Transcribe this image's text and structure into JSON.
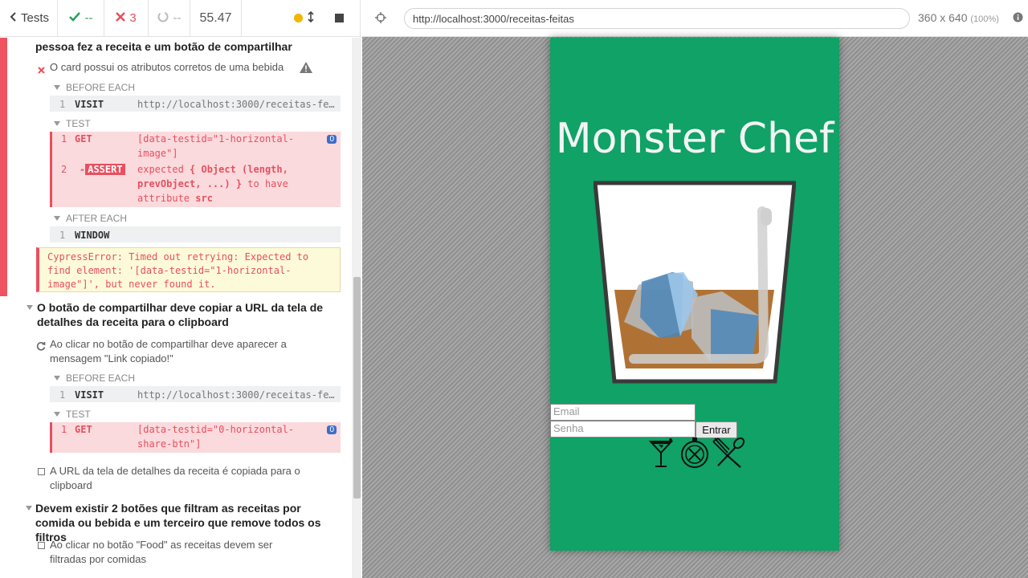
{
  "topbar": {
    "back_label": "Tests",
    "passed": "--",
    "failed": "3",
    "pending": "--",
    "duration": "55.47"
  },
  "reporter": {
    "suite_prev_tail": "pessoa fez a receita e um botão de compartilhar",
    "test1": {
      "title": "O card possui os atributos corretos de uma bebida",
      "before_each": "BEFORE EACH",
      "visit": {
        "num": "1",
        "name": "VISIT",
        "msg": "http://localhost:3000/receitas-feitas"
      },
      "test_label": "TEST",
      "get": {
        "num": "1",
        "name": "GET",
        "msg": "[data-testid=\"1-horizontal-image\"]",
        "badge": "0"
      },
      "assert": {
        "num": "2",
        "name": "ASSERT",
        "msg_a": "expected ",
        "msg_b": "{ Object (length, prevObject, ...) }",
        "msg_c": " to have attribute ",
        "msg_d": "src"
      },
      "after_each": "AFTER EACH",
      "window": {
        "num": "1",
        "name": "WINDOW"
      },
      "error": "CypressError: Timed out retrying: Expected to find element: '[data-testid=\"1-horizontal-image\"]', but never found it."
    },
    "suite2": {
      "title": "O botão de compartilhar deve copiar a URL da tela de detalhes da receita para o clipboard",
      "test": "Ao clicar no botão de compartilhar deve aparecer a mensagem \"Link copiado!\"",
      "before_each": "BEFORE EACH",
      "visit": {
        "num": "1",
        "name": "VISIT",
        "msg": "http://localhost:3000/receitas-feitas"
      },
      "test_label": "TEST",
      "get": {
        "num": "1",
        "name": "GET",
        "msg": "[data-testid=\"0-horizontal-share-btn\"]",
        "badge": "0"
      },
      "test2": "A URL da tela de detalhes da receita é copiada para o clipboard"
    },
    "suite3": {
      "title": "Devem existir 2 botões que filtram as receitas por comida ou bebida e um terceiro que remove todos os filtros",
      "test": "Ao clicar no botão \"Food\" as receitas devem ser filtradas por comidas"
    }
  },
  "aut": {
    "url": "http://localhost:3000/receitas-feitas",
    "viewport": "360 x 640",
    "zoom": "(100%)"
  },
  "app": {
    "title": "Monster Chef",
    "email_placeholder": "Email",
    "password_placeholder": "Senha",
    "submit_label": "Entrar"
  }
}
